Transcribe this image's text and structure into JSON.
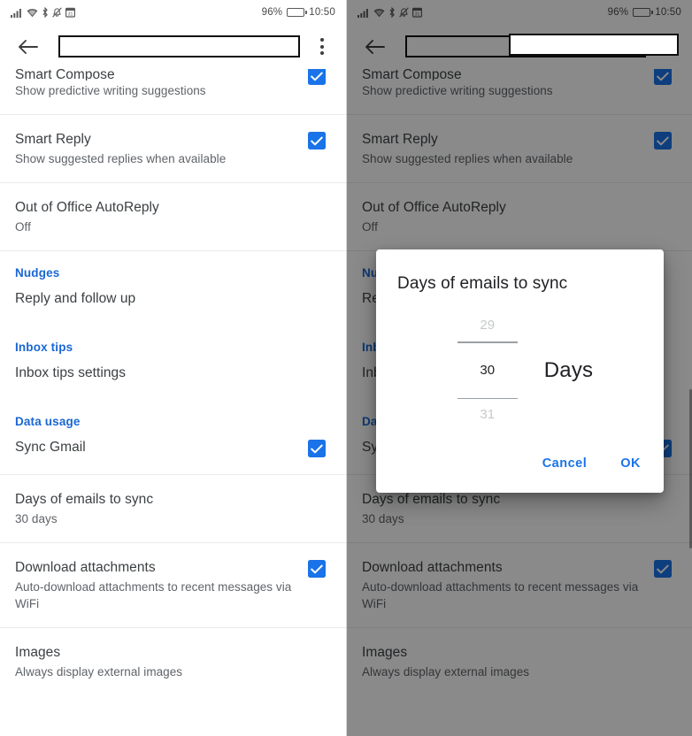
{
  "colors": {
    "accent": "#1a73e8",
    "section_header": "#1967d2",
    "title_text": "#3c4043",
    "sub_text": "#5f6368",
    "divider": "#e8eaed",
    "scrim": "rgba(0,0,0,0.46)"
  },
  "status_bar": {
    "icons": [
      "signal-bars-icon",
      "wifi-icon",
      "bluetooth-icon",
      "notifications-muted-icon",
      "calendar-icon"
    ],
    "battery_percent": "96%",
    "time": "10:50"
  },
  "app_bar": {
    "back_icon": "back-arrow-icon",
    "title": "",
    "overflow_icon": "overflow-menu-icon"
  },
  "settings": {
    "items": [
      {
        "title": "Smart Compose",
        "subtitle": "Show predictive writing suggestions",
        "checked": true,
        "clipped": true
      },
      {
        "title": "Smart Reply",
        "subtitle": "Show suggested replies when available",
        "checked": true
      },
      {
        "title": "Out of Office AutoReply",
        "subtitle": "Off",
        "checked": false
      },
      {
        "section": "Nudges"
      },
      {
        "title": "Reply and follow up",
        "subtitle": "",
        "checked": false
      },
      {
        "section": "Inbox tips"
      },
      {
        "title": "Inbox tips settings",
        "subtitle": "",
        "checked": false
      },
      {
        "section": "Data usage"
      },
      {
        "title": "Sync Gmail",
        "subtitle": "",
        "checked": true
      },
      {
        "title": "Days of emails to sync",
        "subtitle": "30 days",
        "checked": false
      },
      {
        "title": "Download attachments",
        "subtitle": "Auto-download attachments to recent messages via WiFi",
        "checked": true
      },
      {
        "title": "Images",
        "subtitle": "Always display external images",
        "checked": false
      }
    ]
  },
  "dialog": {
    "title": "Days of emails to sync",
    "picker": {
      "previous_value": "29",
      "current_value": "30",
      "next_value": "31",
      "unit_label": "Days"
    },
    "cancel_label": "Cancel",
    "ok_label": "OK"
  }
}
